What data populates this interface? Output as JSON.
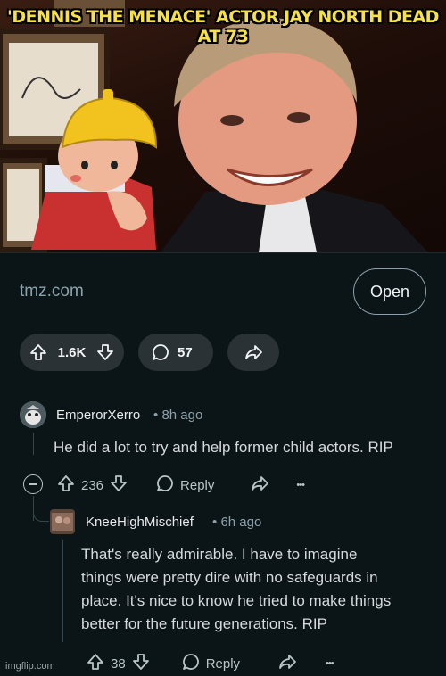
{
  "post": {
    "headline_line1": "'DENNIS THE MENACE' ACTOR JAY NORTH DEAD",
    "headline_line2": "AT 73",
    "domain": "tmz.com",
    "open_label": "Open",
    "score": "1.6K",
    "comment_count": "57"
  },
  "comments": [
    {
      "author": "EmperorXerro",
      "separator": "•",
      "time": "8h ago",
      "body": "He did a lot to try and help former child actors. RIP",
      "score": "236",
      "reply_label": "Reply",
      "more": "•••"
    },
    {
      "author": "KneeHighMischief",
      "separator": "•",
      "time": "6h ago",
      "body_lines": [
        "That's really admirable. I have to imagine",
        "things were pretty dire with no safeguards in",
        "place. It's nice to know he tried to make things",
        "better for the future generations. RIP"
      ],
      "score": "38",
      "reply_label": "Reply",
      "more": "•••"
    }
  ],
  "watermark": "imgflip.com",
  "colors": {
    "background": "#0b1416",
    "pill": "#2a3236",
    "headline": "#f6e14a",
    "muted": "#8ba2ad"
  },
  "icons": [
    "upvote-icon",
    "downvote-icon",
    "comment-icon",
    "share-icon",
    "collapse-icon",
    "more-icon"
  ]
}
